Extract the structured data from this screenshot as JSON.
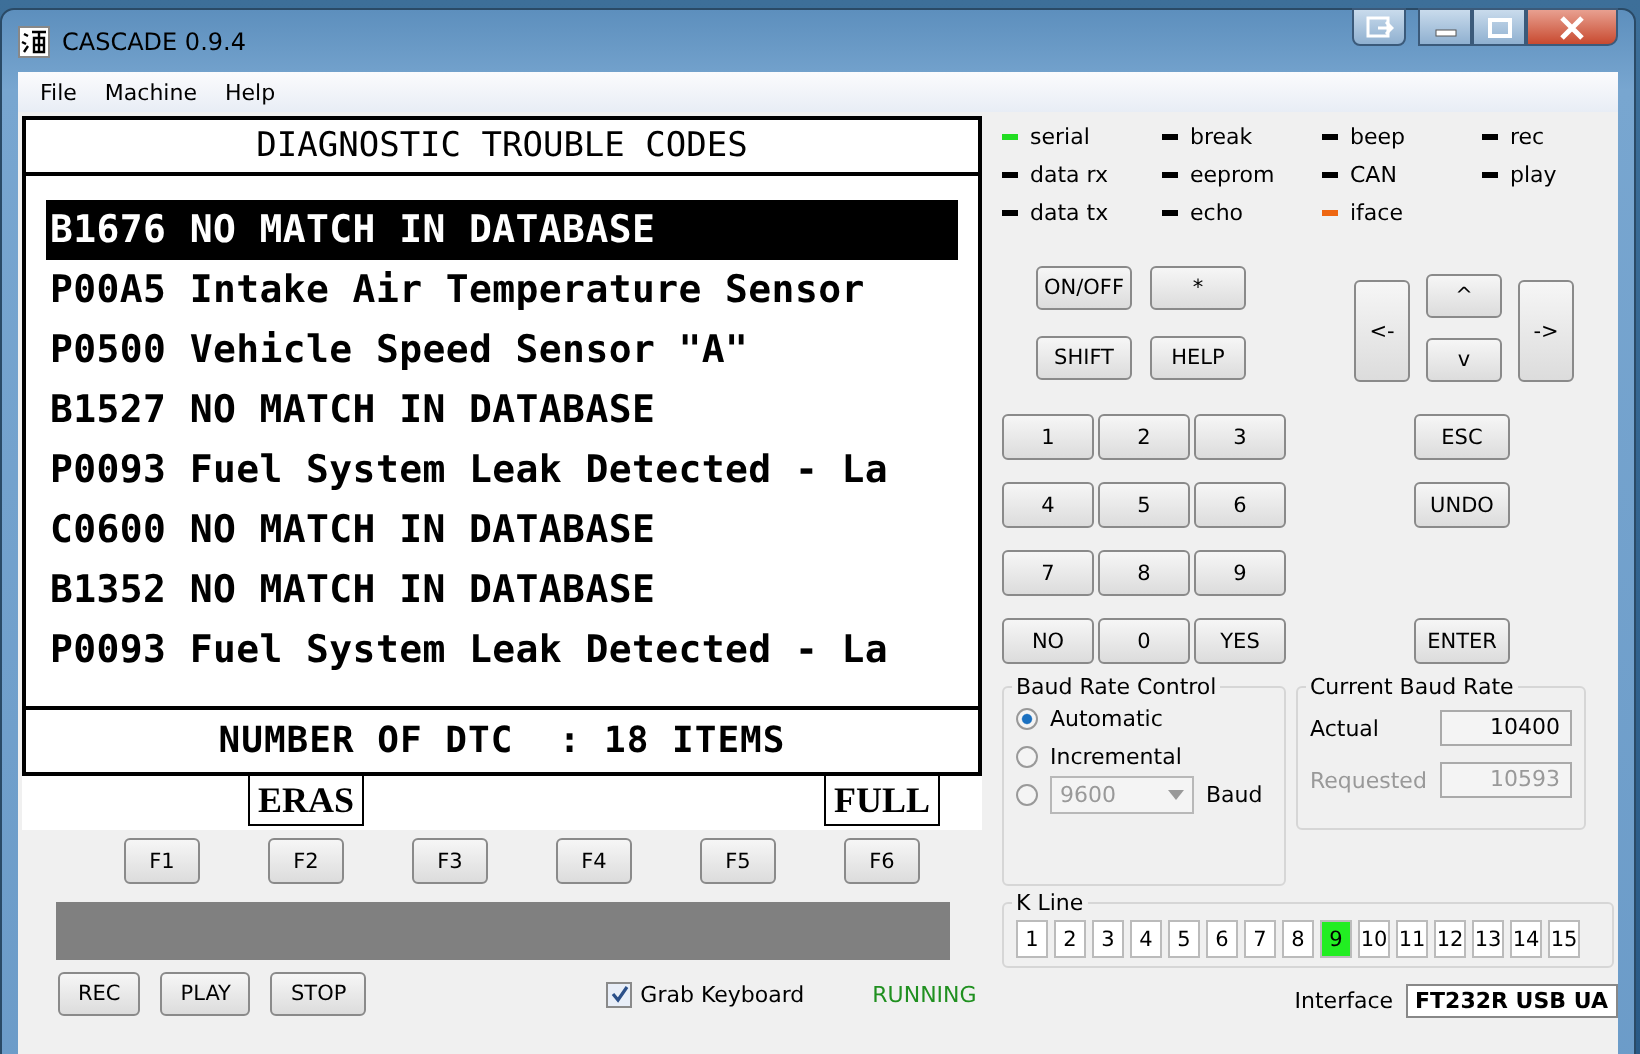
{
  "window": {
    "title": "CASCADE 0.9.4"
  },
  "menu": [
    "File",
    "Machine",
    "Help"
  ],
  "lcd": {
    "title": "DIAGNOSTIC TROUBLE CODES",
    "rows": [
      {
        "text": "B1676 NO MATCH IN DATABASE",
        "selected": true
      },
      {
        "text": "P00A5 Intake Air Temperature Sensor",
        "selected": false
      },
      {
        "text": "P0500 Vehicle Speed Sensor \"A\"",
        "selected": false
      },
      {
        "text": "B1527 NO MATCH IN DATABASE",
        "selected": false
      },
      {
        "text": "P0093 Fuel System Leak Detected - La",
        "selected": false
      },
      {
        "text": "C0600 NO MATCH IN DATABASE",
        "selected": false
      },
      {
        "text": "B1352 NO MATCH IN DATABASE",
        "selected": false
      },
      {
        "text": "P0093 Fuel System Leak Detected - La",
        "selected": false
      }
    ],
    "footer": "NUMBER OF DTC  : 18 ITEMS"
  },
  "function_keys": [
    {
      "label": "F1"
    },
    {
      "label": "F2",
      "soft_label": "ERAS"
    },
    {
      "label": "F3"
    },
    {
      "label": "F4"
    },
    {
      "label": "F5"
    },
    {
      "label": "F6",
      "soft_label": "FULL"
    }
  ],
  "record_buttons": [
    "REC",
    "PLAY",
    "STOP"
  ],
  "grab_keyboard": {
    "label": "Grab Keyboard",
    "checked": true
  },
  "status": "RUNNING",
  "indicators": [
    {
      "label": "serial",
      "color": "#22dd22"
    },
    {
      "label": "break",
      "color": "#000000"
    },
    {
      "label": "beep",
      "color": "#000000"
    },
    {
      "label": "rec",
      "color": "#000000"
    },
    {
      "label": "data rx",
      "color": "#000000"
    },
    {
      "label": "eeprom",
      "color": "#000000"
    },
    {
      "label": "CAN",
      "color": "#000000"
    },
    {
      "label": "play",
      "color": "#000000"
    },
    {
      "label": "data tx",
      "color": "#000000"
    },
    {
      "label": "echo",
      "color": "#000000"
    },
    {
      "label": "iface",
      "color": "#ee6611"
    }
  ],
  "keypad": {
    "top": [
      "ON/OFF",
      "*",
      "SHIFT",
      "HELP"
    ],
    "arrows": [
      "<-",
      "^",
      "v",
      "->"
    ],
    "digits": [
      "1",
      "2",
      "3",
      "4",
      "5",
      "6",
      "7",
      "8",
      "9",
      "NO",
      "0",
      "YES"
    ],
    "side": [
      "ESC",
      "UNDO",
      "ENTER"
    ]
  },
  "baud_control": {
    "title": "Baud Rate Control",
    "options": [
      {
        "kind": "radio",
        "label": "Automatic",
        "selected": true
      },
      {
        "kind": "radio",
        "label": "Incremental",
        "selected": false
      },
      {
        "kind": "dropdown",
        "selected": false
      }
    ],
    "dropdown": {
      "value": "9600",
      "disabled": true
    },
    "unit": "Baud"
  },
  "current_baud": {
    "title": "Current Baud Rate",
    "actual_label": "Actual",
    "actual": "10400",
    "requested_label": "Requested",
    "requested": "10593"
  },
  "k_line": {
    "title": "K Line",
    "lines": [
      {
        "label": "1",
        "selected": false
      },
      {
        "label": "2",
        "selected": false
      },
      {
        "label": "3",
        "selected": false
      },
      {
        "label": "4",
        "selected": false
      },
      {
        "label": "5",
        "selected": false
      },
      {
        "label": "6",
        "selected": false
      },
      {
        "label": "7",
        "selected": false
      },
      {
        "label": "8",
        "selected": false
      },
      {
        "label": "9",
        "selected": true
      },
      {
        "label": "10",
        "selected": false
      },
      {
        "label": "11",
        "selected": false
      },
      {
        "label": "12",
        "selected": false
      },
      {
        "label": "13",
        "selected": false
      },
      {
        "label": "14",
        "selected": false
      },
      {
        "label": "15",
        "selected": false
      }
    ]
  },
  "interface": {
    "label": "Interface",
    "value": "FT232R USB UA"
  }
}
